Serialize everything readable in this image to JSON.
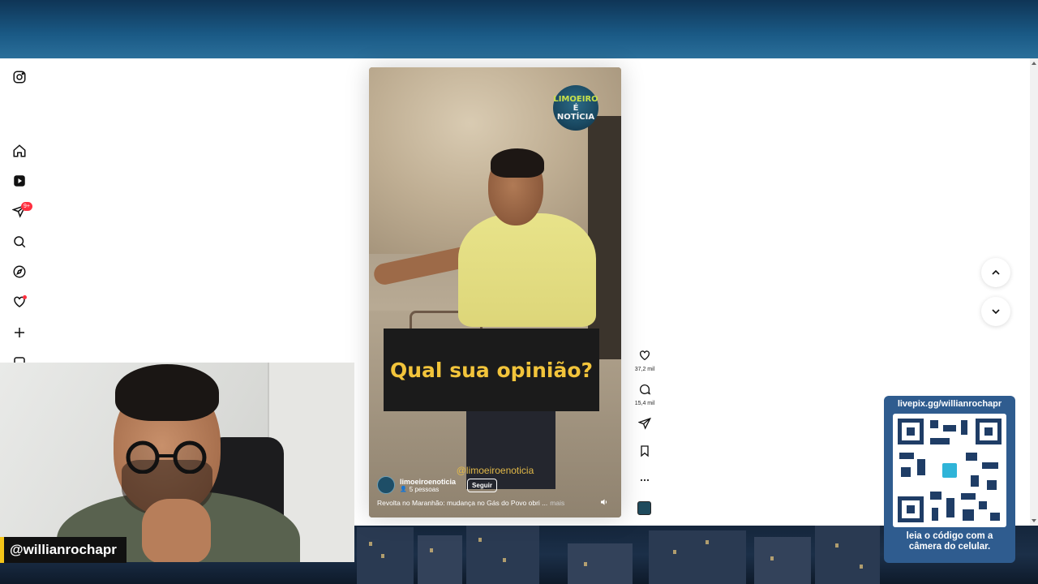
{
  "stream": {
    "handle": "@willianrochapr",
    "qr": {
      "url": "livepix.gg/willianrochapr",
      "label_line1": "leia o código com a",
      "label_line2": "câmera do celular."
    }
  },
  "sidebar": {
    "notification_badge": "9+",
    "items": [
      "instagram-logo",
      "home",
      "reels",
      "direct-messages",
      "search",
      "explore",
      "notifications",
      "create",
      "dashboard"
    ]
  },
  "reel": {
    "logo_line1": "LIMOEIRO",
    "logo_line2": "É NOTÍCIA",
    "caption_overlay": "Qual sua opinião?",
    "watermark": "@limoeiroenoticia",
    "account": {
      "username": "limoeiroenoticia",
      "followers_text": "5 pessoas",
      "follow_label": "Seguir"
    },
    "description": "Revolta no Maranhão: mudança no Gás do Povo obri ...",
    "more_label": "mais"
  },
  "actions": {
    "likes": "37,2 mil",
    "comments": "15,4 mil"
  },
  "colors": {
    "accent_caption": "#f2c43b",
    "badge": "#ff3040",
    "qr_card": "#2f5c8f",
    "handle_bar": "#f5c518"
  }
}
